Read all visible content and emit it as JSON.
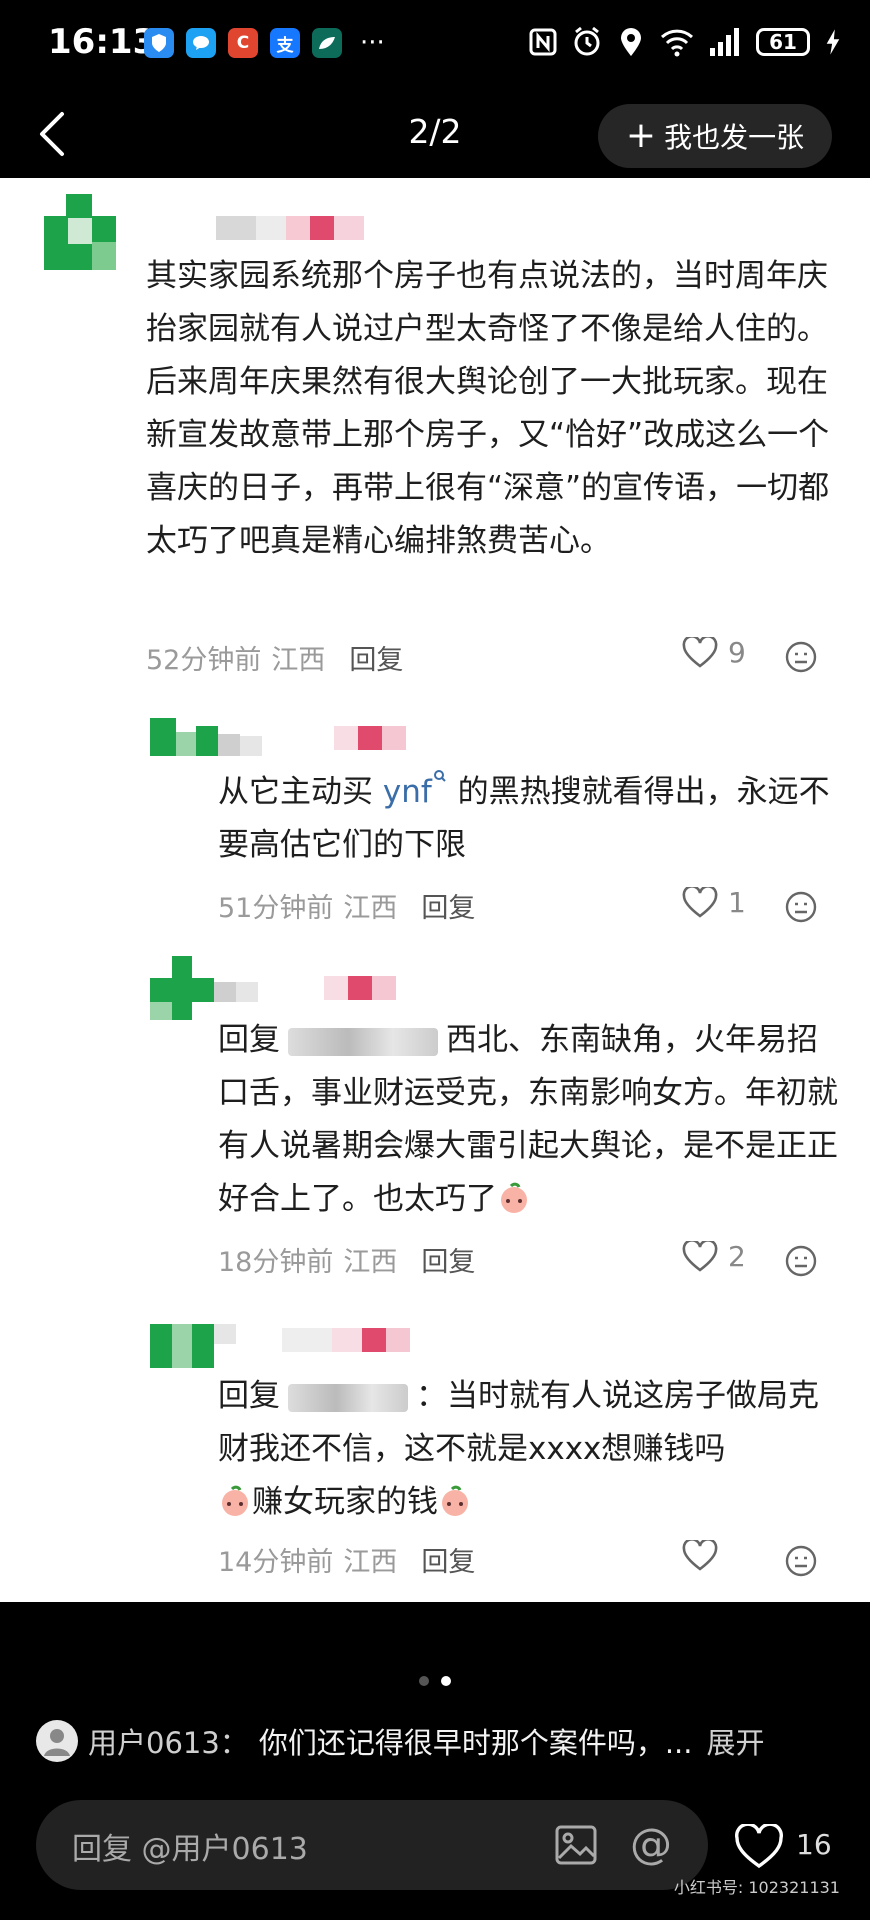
{
  "status_bar": {
    "time": "16:13",
    "more": "···",
    "battery": "61",
    "apps": [
      {
        "icon": "shield-app-icon",
        "glyph": "",
        "color": "#2a8cf0"
      },
      {
        "icon": "chat-app-icon",
        "glyph": "",
        "color": "#1da1f2"
      },
      {
        "icon": "c-app-icon",
        "glyph": "C",
        "color": "#e0452f"
      },
      {
        "icon": "alipay-icon",
        "glyph": "支",
        "color": "#1677ff"
      },
      {
        "icon": "leaf-app-icon",
        "glyph": "",
        "color": "#0d6b5a"
      }
    ]
  },
  "header": {
    "page_counter": "2/2",
    "post_button": "我也发一张"
  },
  "comments": [
    {
      "text": "其实家园系统那个房子也有点说法的，当时周年庆抬家园就有人说过户型太奇怪了不像是给人住的。后来周年庆果然有很大舆论创了一大批玩家。现在新宣发故意带上那个房子，又“恰好”改成这么一个喜庆的日子，再带上很有“深意”的宣传语，一切都太巧了吧真是精心编排煞费苦心。",
      "time": "52分钟前",
      "location": "江西",
      "reply": "回复",
      "likes": "9"
    },
    {
      "text_a": "从它主动买",
      "link": "ynf",
      "text_b": "的黑热搜就看得出，永远不要高估它们的下限",
      "time": "51分钟前",
      "location": "江西",
      "reply": "回复",
      "likes": "1"
    },
    {
      "prefix": "回复",
      "text": "西北、东南缺角，火年易招口舌，事业财运受克，东南影响女方。年初就有人说暑期会爆大雷引起大舆论，是不是正正好合上了。也太巧了",
      "time": "18分钟前",
      "location": "江西",
      "reply": "回复",
      "likes": "2"
    },
    {
      "prefix": "回复",
      "text": "：当时就有人说这房子做局克财我还不信，这不就是xxxx想赚钱吗",
      "text_tail": "赚女玩家的钱",
      "time": "14分钟前",
      "location": "江西",
      "reply": "回复",
      "likes": ""
    }
  ],
  "caption": {
    "user": "用户0613：",
    "text": "你们还记得很早时那个案件吗，...",
    "more": "展开"
  },
  "input": {
    "placeholder": "回复 @用户0613"
  },
  "likes_total": "16",
  "watermark": "小红书号: 102321131"
}
